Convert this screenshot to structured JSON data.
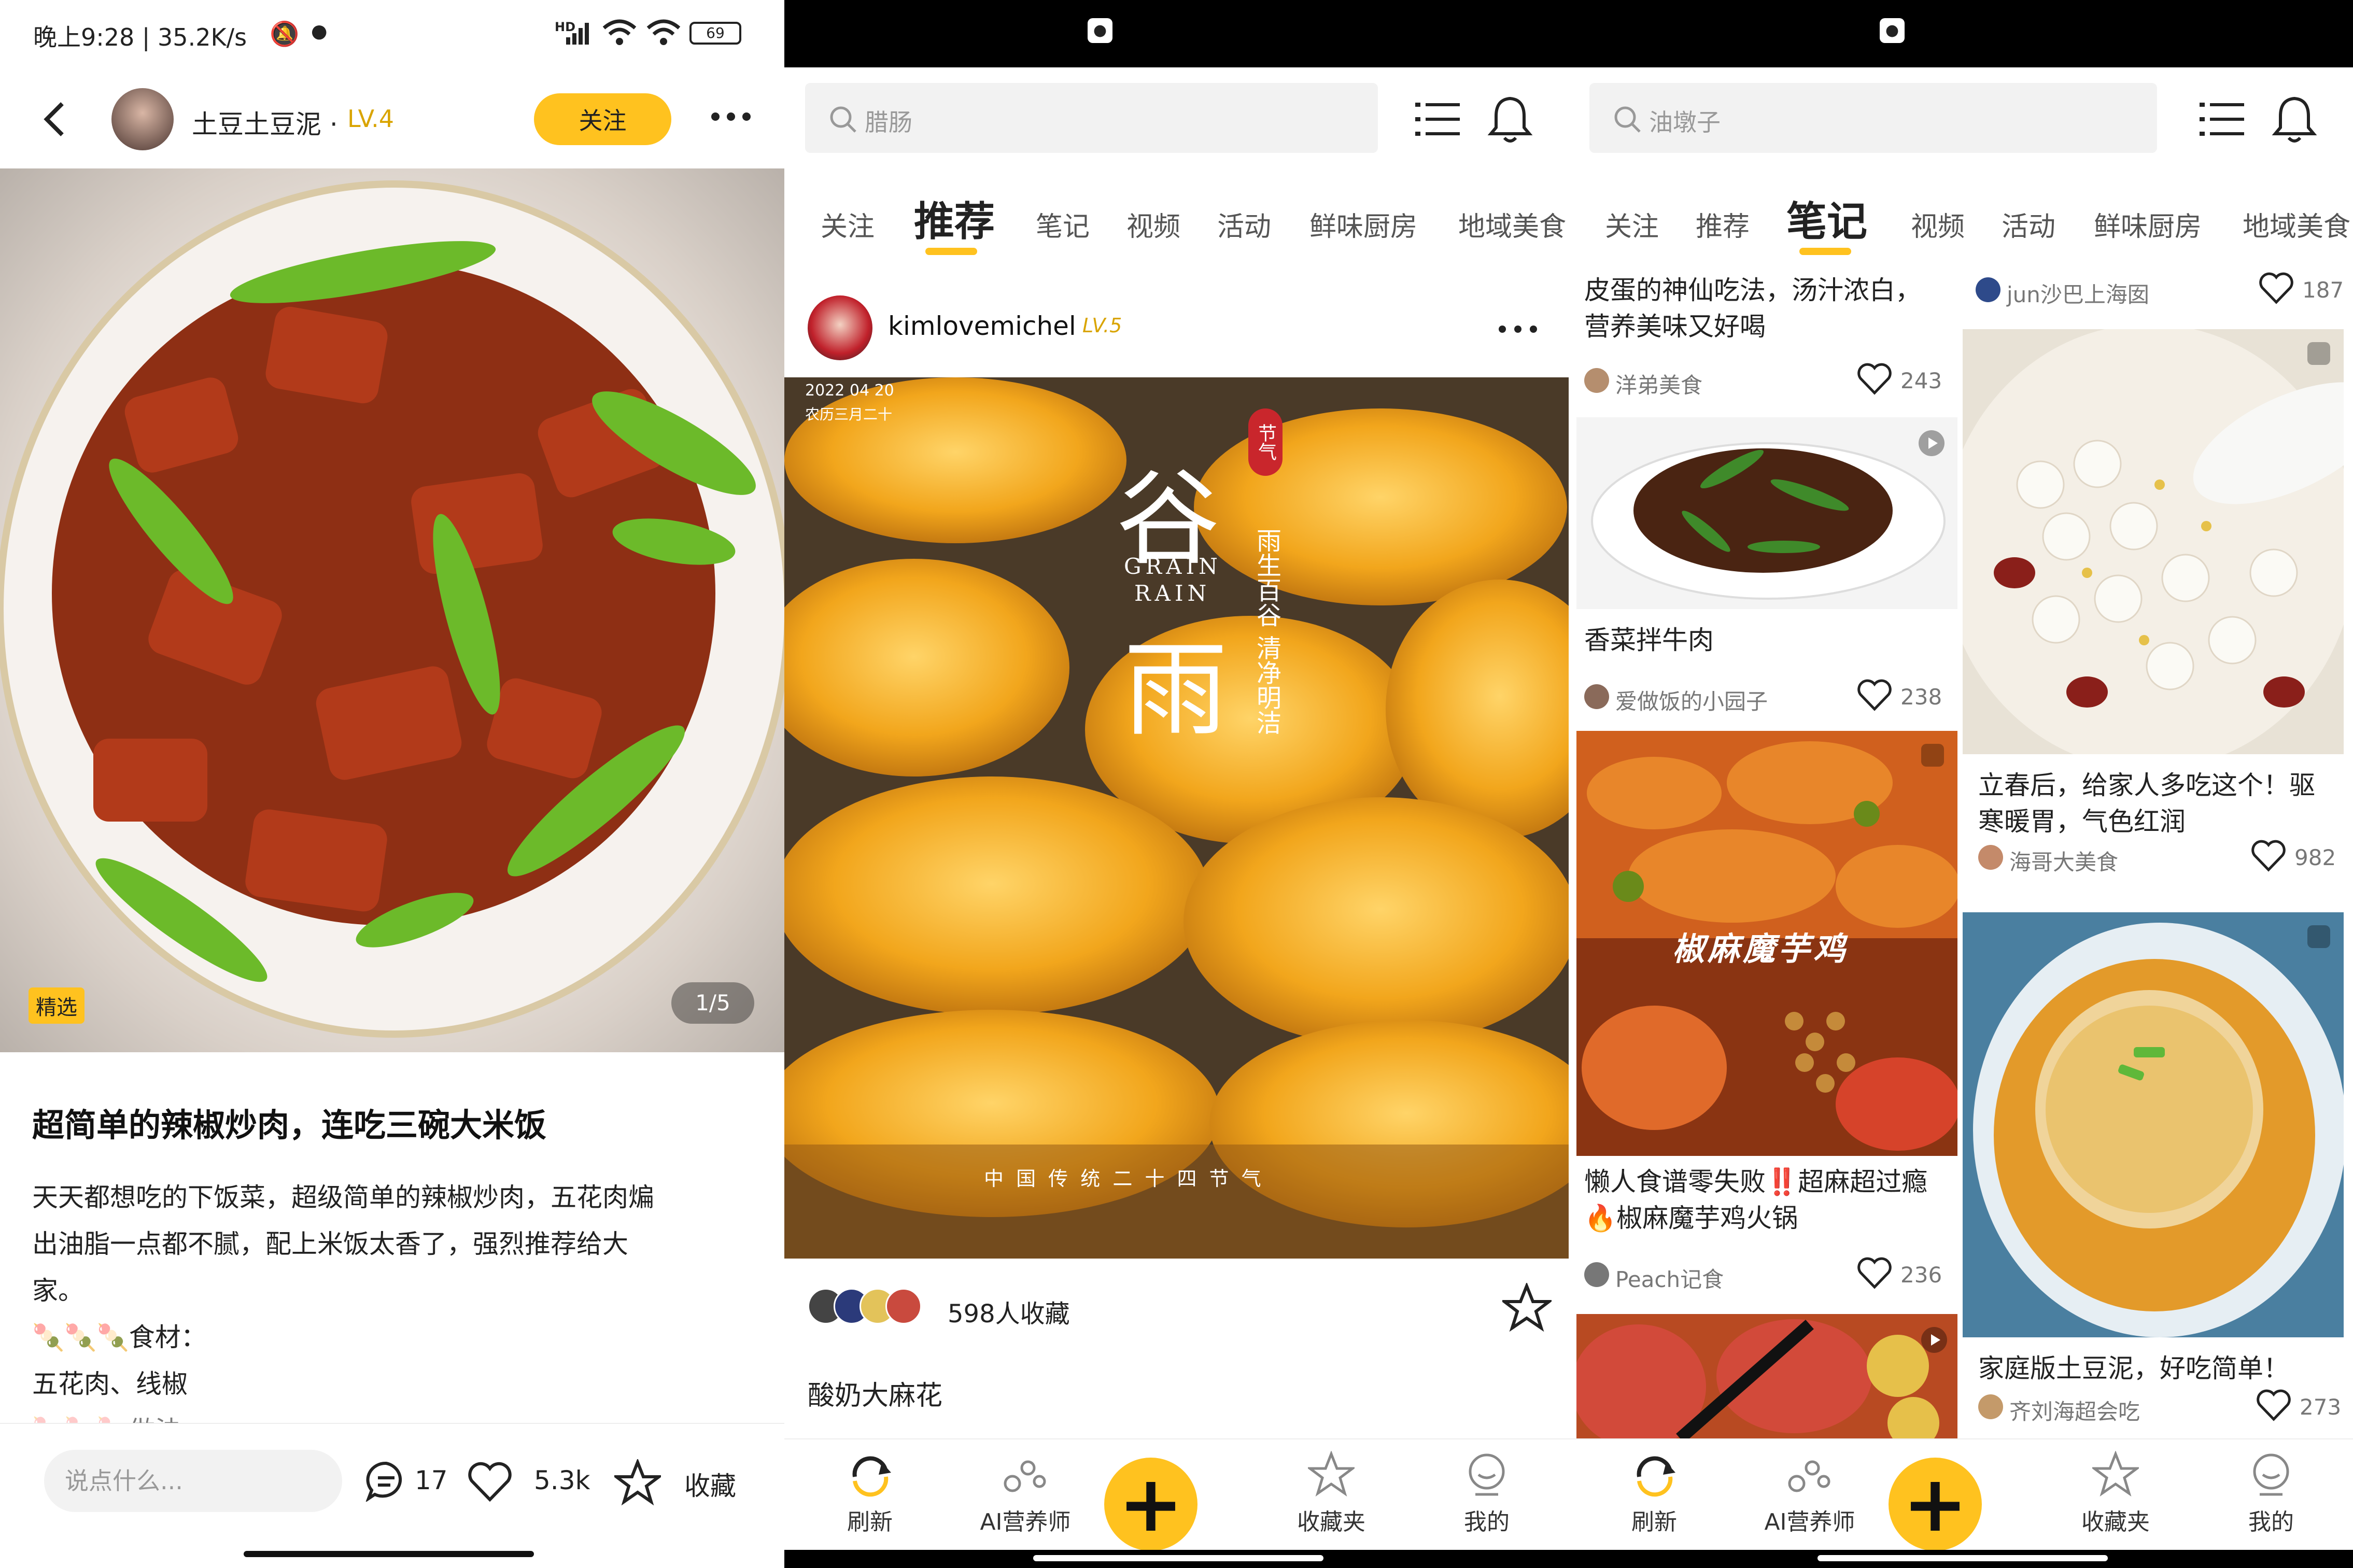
{
  "pane1": {
    "status": {
      "time_speed": "晚上9:28 | 35.2K/s",
      "signal": "HD",
      "battery": "69"
    },
    "header": {
      "username": "土豆土豆泥 · ",
      "level": "LV.4",
      "follow_label": "关注"
    },
    "image": {
      "badge": "精选",
      "page_counter": "1/5"
    },
    "post": {
      "title": "超简单的辣椒炒肉，连吃三碗大米饭",
      "body_line1": "天天都想吃的下饭菜，超级简单的辣椒炒肉，五花肉煸",
      "body_line2": "出油脂一点都不腻，配上米饭太香了，强烈推荐给大",
      "body_line3": "家。",
      "ingredients_label": "食材：",
      "ingredients": "五花肉、线椒",
      "method_label": "做法："
    },
    "bottom": {
      "comment_placeholder": "说点什么...",
      "comment_count": "17",
      "like_count": "5.3k",
      "collect_label": "收藏"
    }
  },
  "pane2": {
    "search": {
      "placeholder": "腊肠"
    },
    "tabs": [
      "关注",
      "推荐",
      "笔记",
      "视频",
      "活动",
      "鲜味厨房",
      "地域美食"
    ],
    "active_tab": "推荐",
    "post": {
      "username": "kimlovemichel",
      "level": "LV.5",
      "img_date": "2022 04 20",
      "img_lunar": "农历三月二十",
      "img_char1": "谷",
      "img_char2": "雨",
      "img_en1": "GRAIN",
      "img_en2": "RAIN",
      "img_badge": "节气",
      "img_vertical": "雨生百谷 清净明洁",
      "img_bottom": "中 国 传 统 二 十 四 节 气",
      "collect_count_text": "598人收藏",
      "title": "酸奶大麻花"
    }
  },
  "pane3": {
    "search": {
      "placeholder": "油墩子"
    },
    "tabs": [
      "关注",
      "推荐",
      "笔记",
      "视频",
      "活动",
      "鲜味厨房",
      "地域美食"
    ],
    "active_tab": "笔记",
    "left_cards": [
      {
        "title": "皮蛋的神仙吃法，汤汁浓白，营养美味又好喝",
        "author": "洋弟美食",
        "likes": "243"
      },
      {
        "title": "香菜拌牛肉",
        "author": "爱做饭的小园子",
        "likes": "238"
      },
      {
        "title": "懒人食谱零失败‼️超麻超过瘾🔥椒麻魔芋鸡火锅",
        "author": "Peach记食",
        "likes": "236",
        "img_text": "椒麻魔芋鸡"
      }
    ],
    "right_cards": [
      {
        "title": "",
        "author": "jun沙巴上海囡",
        "likes": "187"
      },
      {
        "title": "立春后，给家人多吃这个！驱寒暖胃，气色红润",
        "author": "海哥大美食",
        "likes": "982"
      },
      {
        "title": "家庭版土豆泥，好吃简单！",
        "author": "齐刘海超会吃",
        "likes": "273"
      }
    ]
  },
  "nav": {
    "refresh": "刷新",
    "ai": "AI营养师",
    "collections": "收藏夹",
    "me": "我的"
  },
  "colors": {
    "accent": "#ffc21f",
    "level": "#d9a400",
    "text": "#222222"
  }
}
